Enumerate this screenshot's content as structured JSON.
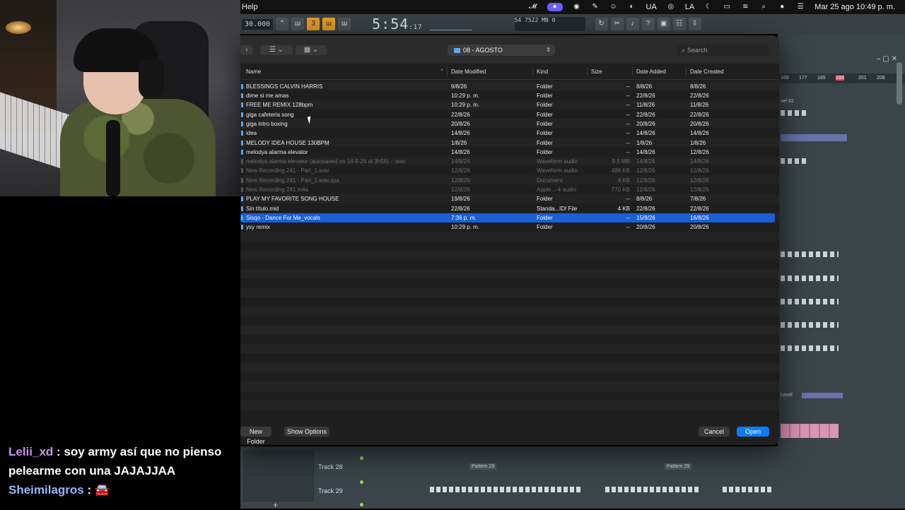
{
  "menubar": {
    "help": "Help",
    "lang": "UA",
    "user_initials": "LA",
    "datetime": "Mar 25 ago  10:49 p. m."
  },
  "fl_toolbar": {
    "tempo": "30.000",
    "time": "5:54",
    "time_frac": ":17",
    "time_label": "M:S:CS",
    "meter_a": "54",
    "meter_b": "7522 MB",
    "meter_c": "0"
  },
  "dialog": {
    "folder": "08 - AGOSTO",
    "search_placeholder": "Search",
    "columns": {
      "name": "Name",
      "date_modified": "Date Modified",
      "kind": "Kind",
      "size": "Size",
      "date_added": "Date Added",
      "date_created": "Date Created"
    },
    "files": [
      {
        "name": "BLESSINGS CALVIN HARRIS",
        "modified": "9/8/26",
        "kind": "Folder",
        "size": "--",
        "added": "8/8/26",
        "created": "8/8/26"
      },
      {
        "name": "dime si me amas",
        "modified": "10:29 p. m.",
        "kind": "Folder",
        "size": "--",
        "added": "22/8/26",
        "created": "22/8/26"
      },
      {
        "name": "FREE ME REMIX 128bpm",
        "modified": "10:29 p. m.",
        "kind": "Folder",
        "size": "--",
        "added": "11/8/26",
        "created": "11/8/26"
      },
      {
        "name": "giga cafeteria song",
        "modified": "22/8/26",
        "kind": "Folder",
        "size": "--",
        "added": "22/8/26",
        "created": "22/8/26"
      },
      {
        "name": "giga intro boxing",
        "modified": "20/8/26",
        "kind": "Folder",
        "size": "--",
        "added": "20/8/26",
        "created": "20/8/26"
      },
      {
        "name": "idea",
        "modified": "14/8/26",
        "kind": "Folder",
        "size": "--",
        "added": "14/8/26",
        "created": "14/8/26"
      },
      {
        "name": "MELODY IDEA HOUSE 130BPM",
        "modified": "1/8/26",
        "kind": "Folder",
        "size": "--",
        "added": "1/8/26",
        "created": "1/8/26"
      },
      {
        "name": "melodya alarma elevator",
        "modified": "14/8/26",
        "kind": "Folder",
        "size": "--",
        "added": "14/8/26",
        "created": "12/8/26"
      },
      {
        "name": "melodya alarma elevator (autosaved on 14-8-26 at 3h56) - .wav",
        "modified": "14/8/26",
        "kind": "Waveform audio",
        "size": "9,5 MB",
        "added": "14/8/26",
        "created": "14/8/26"
      },
      {
        "name": "New Recording 241 - Part_1.wav",
        "modified": "12/8/26",
        "kind": "Waveform audio",
        "size": "488 KB",
        "added": "12/8/26",
        "created": "12/8/26"
      },
      {
        "name": "New Recording 241 - Part_1.wav.zpa",
        "modified": "12/8/26",
        "kind": "Document",
        "size": "4 KB",
        "added": "12/8/26",
        "created": "12/8/26"
      },
      {
        "name": "New Recording 241.m4a",
        "modified": "12/8/26",
        "kind": "Apple...-4 audio",
        "size": "770 KB",
        "added": "12/8/26",
        "created": "12/8/26"
      },
      {
        "name": "PLAY MY FAVORITE SONG HOUSE",
        "modified": "19/8/26",
        "kind": "Folder",
        "size": "--",
        "added": "8/8/26",
        "created": "7/8/26"
      },
      {
        "name": "Sin título.mid",
        "modified": "22/8/26",
        "kind": "Standa...IDI File",
        "size": "4 KB",
        "added": "22/8/26",
        "created": "22/8/26"
      },
      {
        "name": "Sisqo - Dance For Me_vocals",
        "modified": "7:36 p. m.",
        "kind": "Folder",
        "size": "--",
        "added": "15/8/26",
        "created": "16/8/26"
      },
      {
        "name": "ysy remix",
        "modified": "10:29 p. m.",
        "kind": "Folder",
        "size": "--",
        "added": "20/8/26",
        "created": "20/8/26"
      }
    ],
    "new_folder": "New Folder",
    "show_options": "Show Options",
    "cancel": "Cancel",
    "open": "Open"
  },
  "playlist": {
    "track28": "Track 28",
    "track29": "Track 29",
    "pattern": "Pattern 29",
    "ruler": [
      "169",
      "177",
      "185",
      "193",
      "201",
      "209"
    ],
    "level": "Level",
    "lvl2": "vel #2"
  },
  "chat": {
    "msg1_user": "Lelii_xd",
    "msg1_text": ": soy army así que no pienso pelearme con una JAJAJJAA",
    "msg2_user": "Sheimilagros",
    "msg2_text": " : 🚘"
  },
  "colors": {
    "accent": "#0b7ef6",
    "selection": "#1b5fd6",
    "folder": "#5aa8f0"
  }
}
